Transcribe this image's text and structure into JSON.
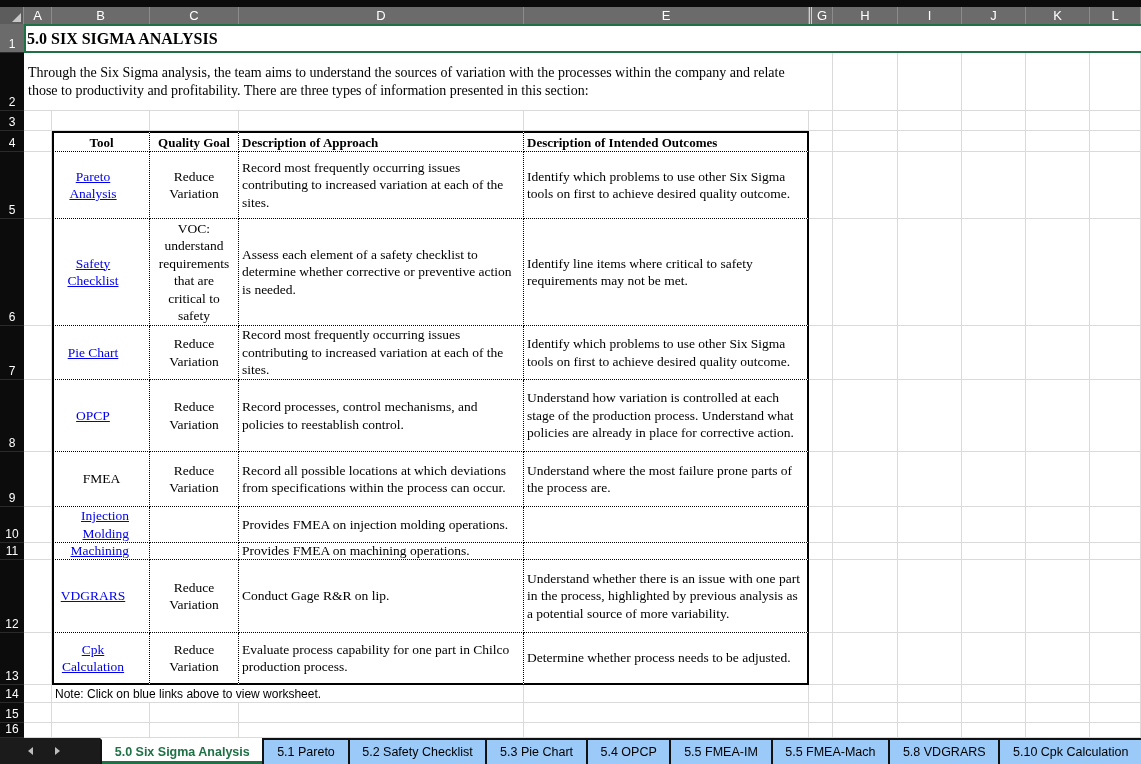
{
  "sheet": {
    "column_headers": [
      {
        "label": "A",
        "hidden_before": false
      },
      {
        "label": "B",
        "hidden_before": false
      },
      {
        "label": "C",
        "hidden_before": false
      },
      {
        "label": "D",
        "hidden_before": false
      },
      {
        "label": "E",
        "hidden_before": false
      },
      {
        "label": "G",
        "hidden_before": true
      },
      {
        "label": "H",
        "hidden_before": false
      },
      {
        "label": "I",
        "hidden_before": false
      },
      {
        "label": "J",
        "hidden_before": false
      },
      {
        "label": "K",
        "hidden_before": false
      },
      {
        "label": "L",
        "hidden_before": false
      }
    ],
    "row_headers": [
      {
        "label": "1",
        "selected": true
      },
      {
        "label": "2",
        "selected": false
      },
      {
        "label": "3",
        "selected": false
      },
      {
        "label": "4",
        "selected": false
      },
      {
        "label": "5",
        "selected": false
      },
      {
        "label": "6",
        "selected": false
      },
      {
        "label": "7",
        "selected": false
      },
      {
        "label": "8",
        "selected": false
      },
      {
        "label": "9",
        "selected": false
      },
      {
        "label": "10",
        "selected": false
      },
      {
        "label": "11",
        "selected": false
      },
      {
        "label": "12",
        "selected": false
      },
      {
        "label": "13",
        "selected": false
      },
      {
        "label": "14",
        "selected": false
      },
      {
        "label": "15",
        "selected": false
      },
      {
        "label": "16",
        "selected": false
      }
    ],
    "title": "5.0 SIX SIGMA ANALYSIS",
    "intro": "Through the Six Sigma analysis, the team aims to understand the sources of variation with the processes within the company and relate those to productivity and profitability. There are three types of information presented in this section:",
    "table": {
      "columns": [
        "Tool",
        "Quality Goal",
        "Description of Approach",
        "Description of Intended Outcomes"
      ],
      "rows": [
        {
          "tool": {
            "text": "Pareto Analysis",
            "link": true
          },
          "goal": "Reduce Variation",
          "approach": "Record most frequently occurring issues contributing to increased variation at each of the sites.",
          "outcome": "Identify which problems to use other Six Sigma tools on first to achieve desired quality outcome."
        },
        {
          "tool": {
            "text": "Safety Checklist",
            "link": true
          },
          "goal": "VOC: understand requirements that are critical to safety",
          "approach": "Assess each element of a safety checklist to determine whether corrective or preventive action is needed.",
          "outcome": "Identify line items where critical to safety requirements may not be met."
        },
        {
          "tool": {
            "text": "Pie Chart",
            "link": true
          },
          "goal": "Reduce Variation",
          "approach": "Record most frequently occurring issues contributing to increased variation at each of the sites.",
          "outcome": "Identify which problems to use other Six Sigma tools on first to achieve desired quality outcome."
        },
        {
          "tool": {
            "text": "OPCP",
            "link": true
          },
          "goal": "Reduce Variation",
          "approach": "Record processes, control mechanisms, and policies to reestablish control.",
          "outcome": "Understand how variation is controlled at each stage of the production process. Understand what policies are already in place for corrective action."
        },
        {
          "tool": {
            "text": "FMEA",
            "link": false
          },
          "goal": "Reduce Variation",
          "approach": "Record all possible locations at which deviations from specifications within the process can occur.",
          "outcome": "Understand where the most failure prone parts of the process are.",
          "children": [
            {
              "tool": {
                "text": "Injection Molding",
                "link": true
              },
              "approach": "Provides FMEA on injection molding operations."
            },
            {
              "tool": {
                "text": "Machining",
                "link": true
              },
              "approach": "Provides FMEA on machining operations."
            }
          ]
        },
        {
          "tool": {
            "text": "VDGRARS",
            "link": true
          },
          "goal": "Reduce Variation",
          "approach": "Conduct Gage R&R on lip.",
          "outcome": "Understand whether there is an issue with one part in the process, highlighted by previous analysis as a potential source of more variability."
        },
        {
          "tool": {
            "text": "Cpk Calculation",
            "link": true
          },
          "goal": "Reduce Variation",
          "approach": "Evaluate process capability for one part in Chilco production process.",
          "outcome": "Determine whether process needs to be adjusted."
        }
      ]
    },
    "note": "Note: Click on blue links above to view worksheet."
  },
  "sheet_tabs": [
    {
      "label": "5.0 Six Sigma Analysis",
      "selected": true
    },
    {
      "label": "5.1 Pareto",
      "selected": false
    },
    {
      "label": "5.2 Safety Checklist",
      "selected": false
    },
    {
      "label": "5.3 Pie Chart",
      "selected": false
    },
    {
      "label": "5.4 OPCP",
      "selected": false
    },
    {
      "label": "5.5 FMEA-IM",
      "selected": false
    },
    {
      "label": "5.5 FMEA-Mach",
      "selected": false
    },
    {
      "label": "5.8 VDGRARS",
      "selected": false
    },
    {
      "label": "5.10 Cpk Calculation",
      "selected": false
    }
  ]
}
